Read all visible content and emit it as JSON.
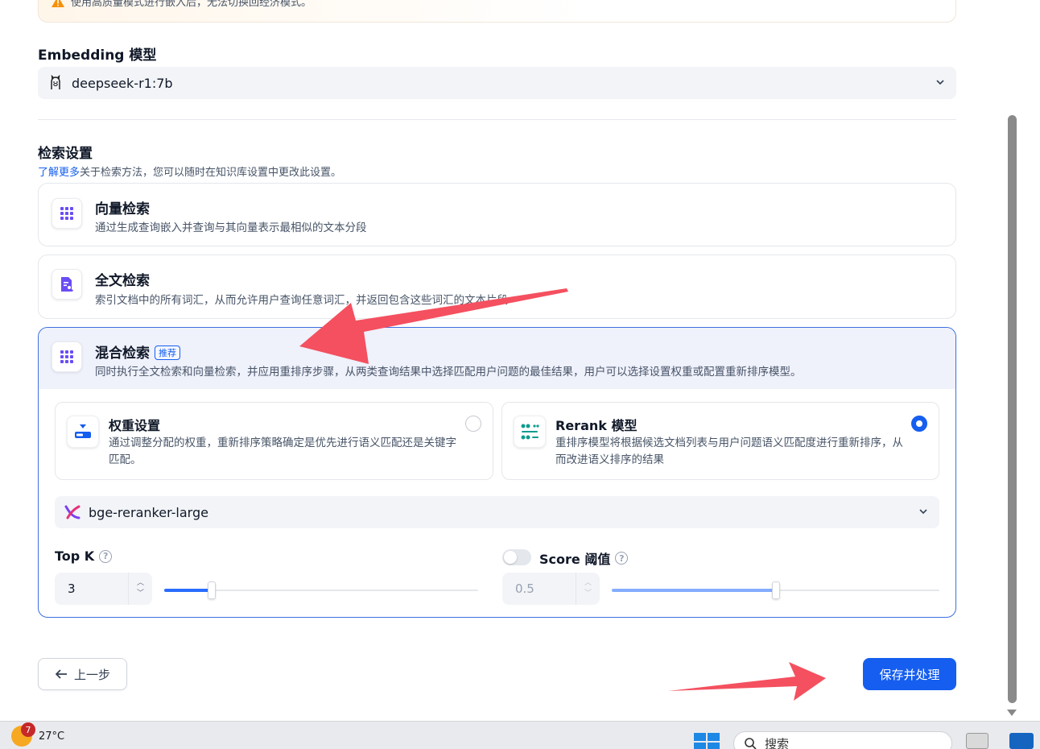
{
  "warning": {
    "text": "使用高质量模式进行嵌入后，无法切换回经济模式。"
  },
  "embedding": {
    "title": "Embedding 模型",
    "selected_model": "deepseek-r1:7b"
  },
  "retrieval": {
    "title": "检索设置",
    "learn_more": "了解更多",
    "learn_more_suffix": "关于检索方法，您可以随时在知识库设置中更改此设置。",
    "methods": [
      {
        "title": "向量检索",
        "desc": "通过生成查询嵌入并查询与其向量表示最相似的文本分段"
      },
      {
        "title": "全文检索",
        "desc": "索引文档中的所有词汇，从而允许用户查询任意词汇，并返回包含这些词汇的文本片段"
      },
      {
        "title": "混合检索",
        "badge": "推荐",
        "desc": "同时执行全文检索和向量检索，并应用重排序步骤，从两类查询结果中选择匹配用户问题的最佳结果，用户可以选择设置权重或配置重新排序模型。"
      }
    ],
    "hybrid": {
      "options": [
        {
          "title": "权重设置",
          "desc": "通过调整分配的权重，重新排序策略确定是优先进行语义匹配还是关键字匹配。",
          "selected": false
        },
        {
          "title": "Rerank 模型",
          "desc": "重排序模型将根据候选文档列表与用户问题语义匹配度进行重新排序，从而改进语义排序的结果",
          "selected": true
        }
      ],
      "rerank_model": "bge-reranker-large",
      "top_k": {
        "label": "Top K",
        "value": "3",
        "slider_fraction": 0.15
      },
      "score": {
        "label": "Score 阈值",
        "value": "0.5",
        "enabled": false,
        "slider_fraction": 0.5
      }
    }
  },
  "footer": {
    "prev_label": "上一步",
    "save_label": "保存并处理"
  },
  "taskbar": {
    "notification_count": "7",
    "temperature": "27°C",
    "search_placeholder": "搜索"
  },
  "colors": {
    "primary": "#155eef",
    "annotation_arrow": "#f4505f"
  }
}
